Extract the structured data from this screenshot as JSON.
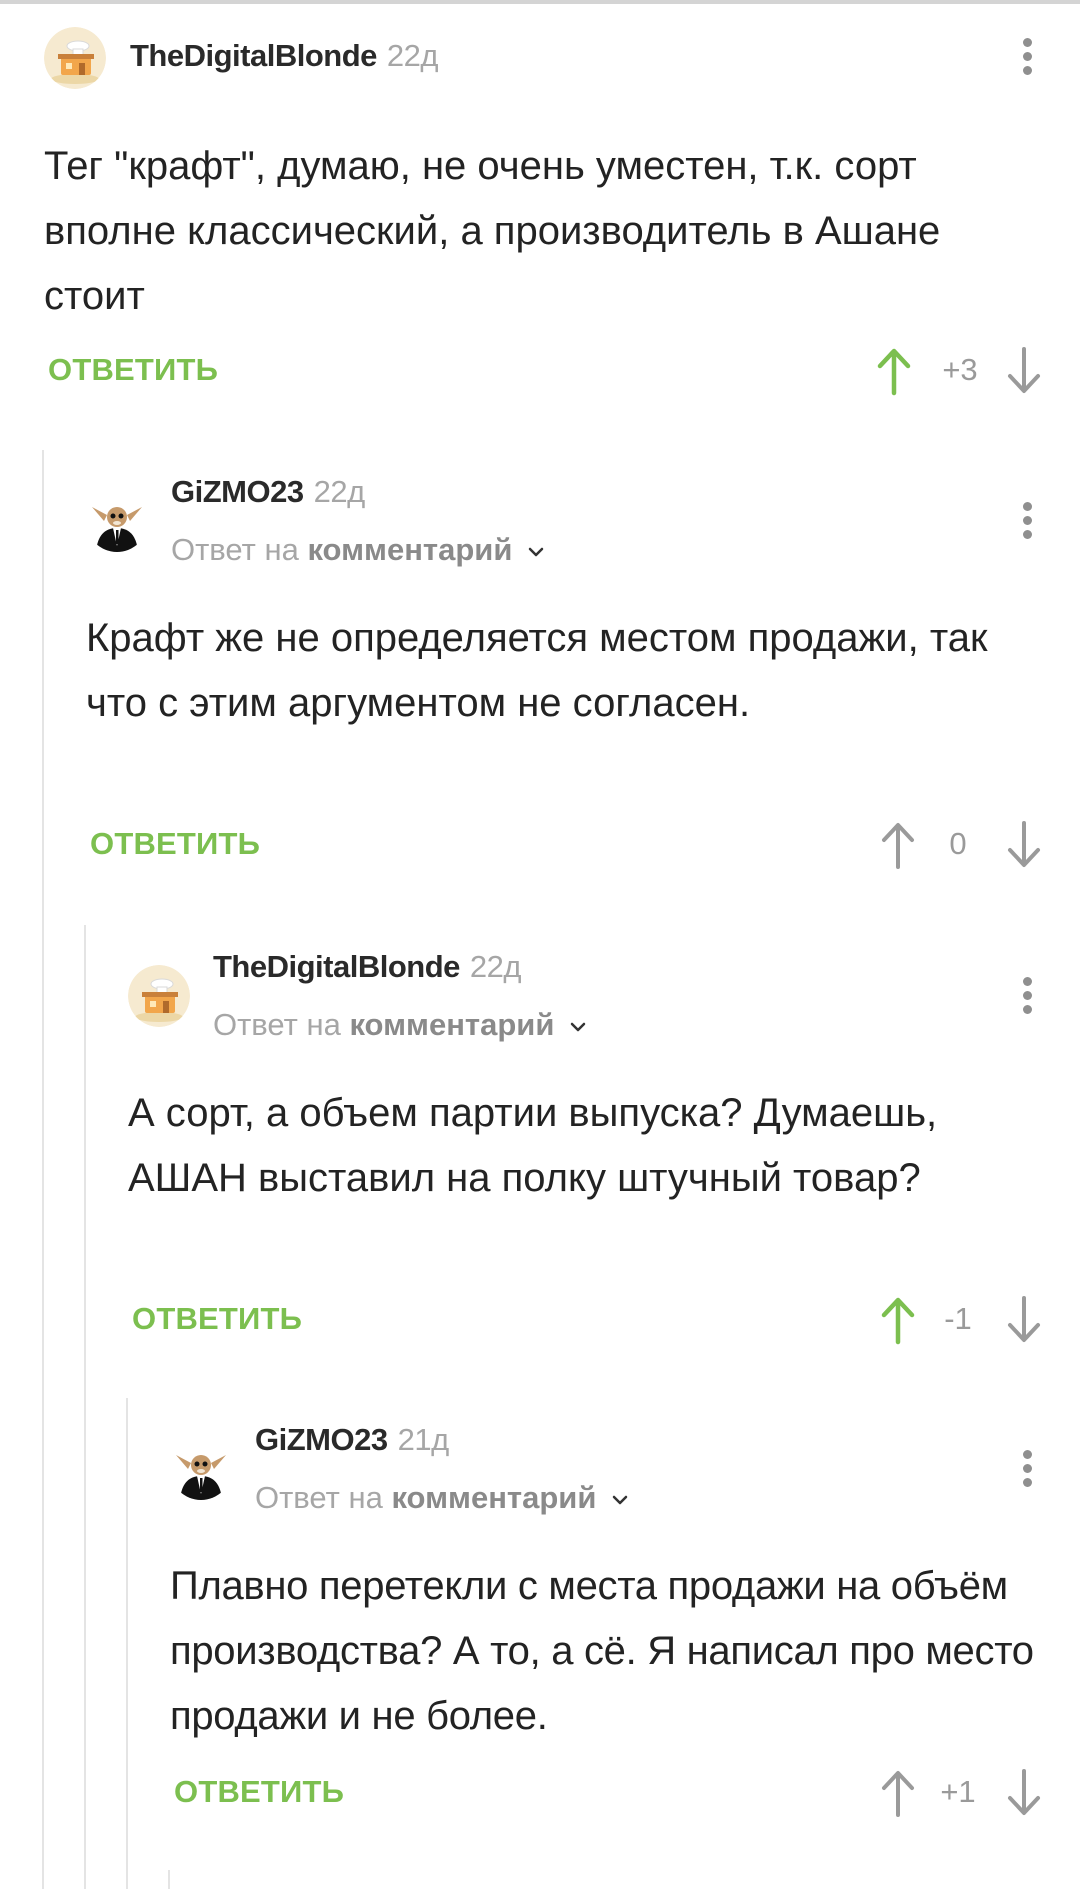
{
  "comments": [
    {
      "author": "TheDigitalBlonde",
      "age": "22д",
      "reply_prefix": "",
      "reply_link": "",
      "text": "Тег \"крафт\", думаю, не очень уместен, т.к. сорт вполне классический, а производитель в Ашане стоит",
      "reply_label": "ОТВЕТИТЬ",
      "score": "+3",
      "upvoted": true
    },
    {
      "author": "GiZMO23",
      "age": "22д",
      "reply_prefix": "Ответ на",
      "reply_link": "комментарий",
      "text": "Крафт же не определяется местом продажи, так что с этим аргументом не согласен.",
      "reply_label": "ОТВЕТИТЬ",
      "score": "0",
      "upvoted": false
    },
    {
      "author": "TheDigitalBlonde",
      "age": "22д",
      "reply_prefix": "Ответ на",
      "reply_link": "комментарий",
      "text": "А сорт, а объем партии выпуска? Думаешь, АШАН выставил на полку штучный товар?",
      "reply_label": "ОТВЕТИТЬ",
      "score": "-1",
      "upvoted": true
    },
    {
      "author": "GiZMO23",
      "age": "21д",
      "reply_prefix": "Ответ на",
      "reply_link": "комментарий",
      "text": "Плавно перетекли с места продажи на объём производства? А то, а сё. Я написал про место продажи и не более.",
      "reply_label": "ОТВЕТИТЬ",
      "score": "+1",
      "upvoted": false
    }
  ],
  "colors": {
    "accent_green": "#7cbf4f",
    "muted_gray": "#a6a6a6",
    "thread_line": "#e4e4e4"
  },
  "icons": {
    "more": "more-vertical-icon",
    "upvote": "arrow-up-icon",
    "downvote": "arrow-down-icon",
    "expand": "chevron-down-icon",
    "avatar_blonde": "house-cake-avatar",
    "avatar_gizmo": "gremlin-in-suit-avatar"
  }
}
